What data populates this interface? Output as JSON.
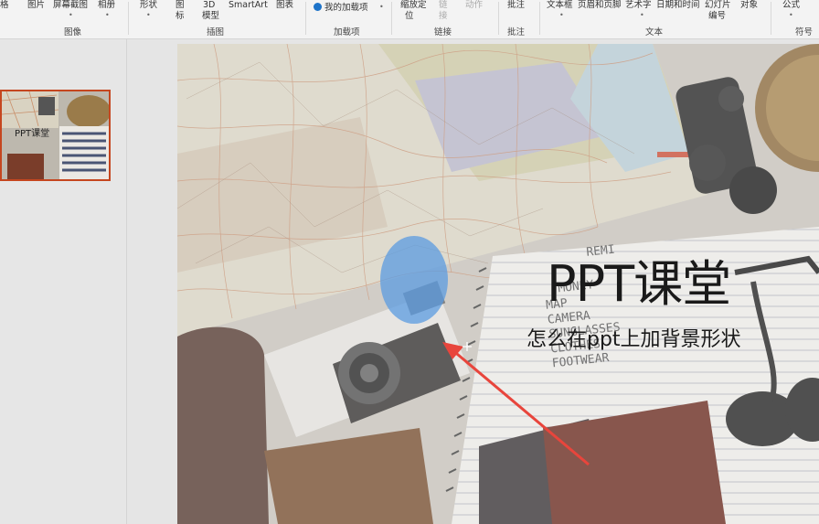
{
  "ribbon": {
    "row1": {
      "picture": "图片",
      "screenshot": "屏幕截图",
      "album": "相册",
      "shapes": "形状",
      "icons": "图",
      "model3d": "3D",
      "smartart": "SmartArt",
      "chart": "图表",
      "my_addins": "我的加载项",
      "zoom": "缩放定",
      "link": "链",
      "action": "动作",
      "comment": "批注",
      "textbox": "文本框",
      "header_footer": "页眉和页脚",
      "wordart": "艺术字",
      "datetime": "日期和时间",
      "slide_number": "幻灯片",
      "object": "对象",
      "equation": "公式"
    },
    "row2": {
      "icons": "标",
      "model3d": "模型",
      "zoom": "位",
      "link": "接",
      "slide_number": "编号"
    },
    "groups": {
      "images": "图像",
      "illustrations": "插图",
      "addins": "加载项",
      "links": "链接",
      "comments": "批注",
      "text": "文本",
      "symbols": "符号"
    }
  },
  "thumbnail": {
    "title": "PPT课堂"
  },
  "slide": {
    "title": "PPT课堂",
    "subtitle": "怎么在ppt上加背景形状",
    "notebook_lines": [
      "REMI",
      "MONEY",
      "MAP",
      "CAMERA",
      "SUNGLASSES",
      "CLOTHES",
      "FOOTWEAR"
    ]
  },
  "colors": {
    "ellipse": "#5b9be0",
    "arrow": "#e8453c",
    "thumb_border": "#c5461f"
  }
}
